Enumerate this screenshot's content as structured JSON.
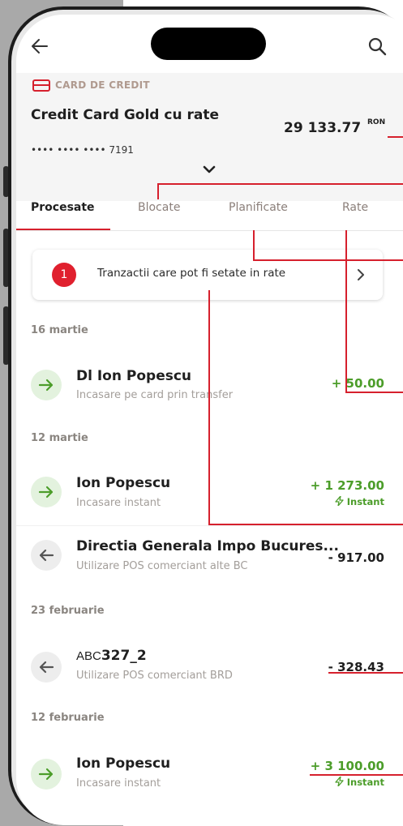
{
  "header": {
    "card_type": "CARD DE CREDIT",
    "card_name": "Credit Card Gold cu rate",
    "card_number": "•••• •••• •••• 7191",
    "balance": "29 133.77",
    "currency": "RON"
  },
  "tabs": [
    {
      "label": "Procesate",
      "active": true
    },
    {
      "label": "Blocate",
      "active": false
    },
    {
      "label": "Planificate",
      "active": false
    },
    {
      "label": "Rate",
      "active": false
    }
  ],
  "banner": {
    "badge": "1",
    "text": "Tranzactii care pot fi setate in rate"
  },
  "groups": [
    {
      "date": "16 martie"
    },
    {
      "date": "12 martie"
    },
    {
      "date": "23 februarie"
    },
    {
      "date": "12 februarie"
    }
  ],
  "transactions": [
    {
      "title": "Dl Ion Popescu",
      "subtitle": "Incasare pe card prin transfer",
      "amount": "+ 50.00",
      "direction": "in"
    },
    {
      "title": "Ion Popescu",
      "subtitle": "Incasare instant",
      "amount": "+ 1 273.00",
      "direction": "in",
      "tag": "Instant"
    },
    {
      "title": "Directia Generala Impo Bucures...",
      "subtitle": "Utilizare POS comerciant alte BC",
      "amount": "- 917.00",
      "direction": "out"
    },
    {
      "title_prefix": "ABC",
      "title": "327_2",
      "subtitle": "Utilizare POS comerciant BRD",
      "amount": "- 328.43",
      "direction": "out"
    },
    {
      "title": "Ion Popescu",
      "subtitle": "Incasare instant",
      "amount": "+ 3 100.00",
      "direction": "in",
      "tag": "Instant"
    }
  ],
  "colors": {
    "accent": "#d6202d",
    "positive": "#4c9d2a",
    "muted": "#a39e9a"
  },
  "icons": [
    "back-arrow-icon",
    "search-icon",
    "credit-card-icon",
    "chevron-down-icon",
    "chevron-right-icon",
    "arrow-right-icon",
    "arrow-left-icon",
    "lightning-icon"
  ]
}
